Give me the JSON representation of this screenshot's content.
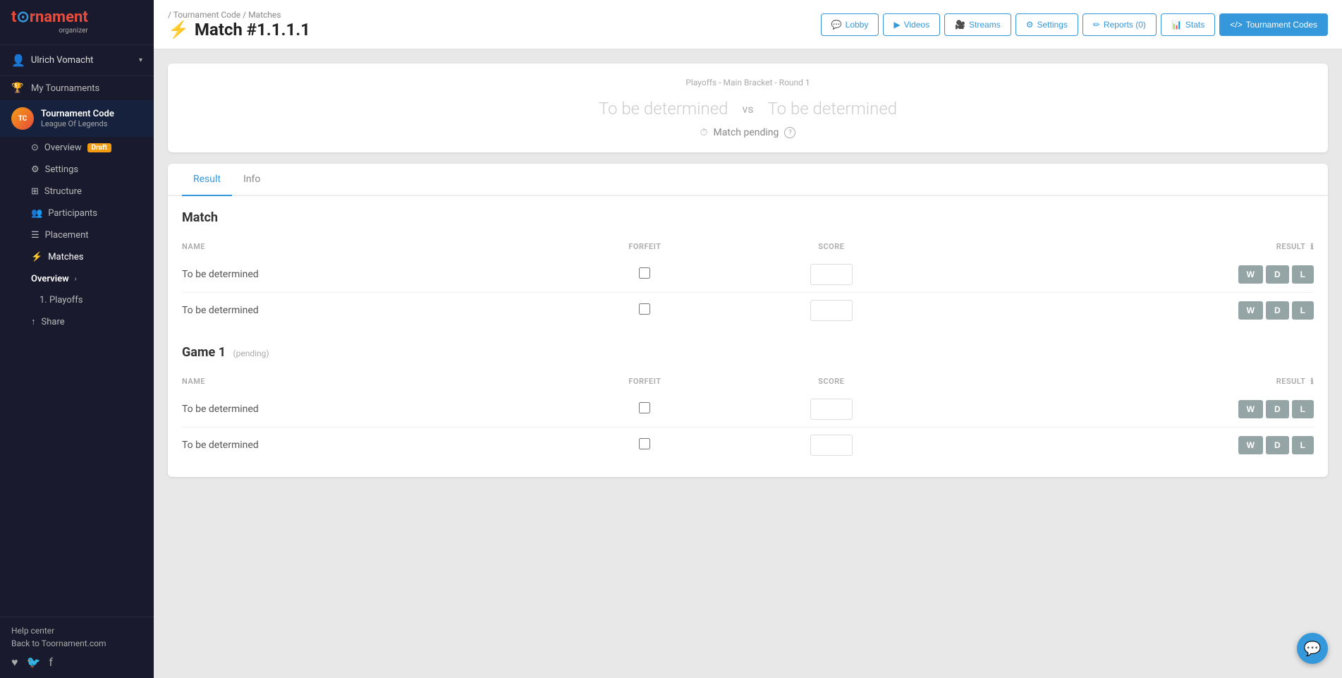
{
  "app": {
    "name": "t",
    "name_highlight": "o",
    "name_rest": "rnament",
    "sub": "organizer"
  },
  "user": {
    "name": "Ulrich Vomacht",
    "arrow": "▾"
  },
  "sidebar": {
    "my_tournaments_label": "My Tournaments",
    "tournament": {
      "name": "Tournament Code",
      "game": "League Of Legends"
    },
    "items": [
      {
        "label": "Overview",
        "icon": "⊙",
        "badge": "Draft"
      },
      {
        "label": "Settings",
        "icon": "⚙"
      },
      {
        "label": "Structure",
        "icon": "⊞"
      },
      {
        "label": "Participants",
        "icon": "👥"
      },
      {
        "label": "Placement",
        "icon": "☰"
      },
      {
        "label": "Matches",
        "icon": "⚡",
        "active": true
      }
    ],
    "matches_sub": {
      "label": "Overview",
      "arrow": "›"
    },
    "playoffs_label": "1. Playoffs",
    "share_label": "Share",
    "help_label": "Help center",
    "back_label": "Back to Toornament.com"
  },
  "header": {
    "breadcrumb_part1": "/ Tournament Code",
    "breadcrumb_part2": "/ Matches",
    "title_icon": "⚡",
    "title": "Match #1.1.1.1"
  },
  "nav_buttons": [
    {
      "label": "Lobby",
      "icon": "💬",
      "active": false
    },
    {
      "label": "Videos",
      "icon": "▶",
      "active": false
    },
    {
      "label": "Streams",
      "icon": "🎥",
      "active": false
    },
    {
      "label": "Settings",
      "icon": "⚙",
      "active": false
    },
    {
      "label": "Reports (0)",
      "icon": "✏",
      "active": false
    },
    {
      "label": "Stats",
      "icon": "📊",
      "active": false
    },
    {
      "label": "Tournament Codes",
      "icon": "</>",
      "active": true
    }
  ],
  "match_header": {
    "round_label": "Playoffs - Main Bracket - Round 1",
    "team1": "To be determined",
    "vs": "vs",
    "team2": "To be determined",
    "status_icon": "⏱",
    "status_text": "Match pending",
    "status_help": "?"
  },
  "tabs": [
    {
      "label": "Result",
      "active": true
    },
    {
      "label": "Info",
      "active": false
    }
  ],
  "match_section": {
    "title": "Match",
    "columns": {
      "name": "NAME",
      "forfeit": "FORFEIT",
      "score": "SCORE",
      "result": "RESULT"
    },
    "rows": [
      {
        "name": "To be determined",
        "forfeit": false,
        "score": "",
        "w": "W",
        "d": "D",
        "l": "L"
      },
      {
        "name": "To be determined",
        "forfeit": false,
        "score": "",
        "w": "W",
        "d": "D",
        "l": "L"
      }
    ]
  },
  "game1_section": {
    "title": "Game 1",
    "pending_label": "(pending)",
    "columns": {
      "name": "NAME",
      "forfeit": "FORFEIT",
      "score": "SCORE",
      "result": "RESULT"
    },
    "rows": [
      {
        "name": "To be determined",
        "forfeit": false,
        "score": "",
        "w": "W",
        "d": "D",
        "l": "L"
      },
      {
        "name": "To be determined",
        "forfeit": false,
        "score": "",
        "w": "W",
        "d": "D",
        "l": "L"
      }
    ]
  }
}
